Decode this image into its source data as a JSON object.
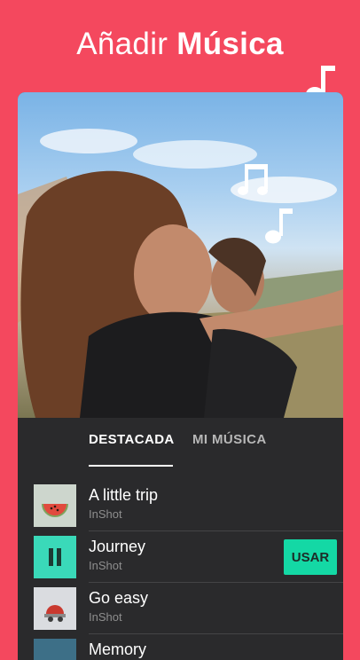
{
  "headline": {
    "regular": "Añadir",
    "bold": "Música"
  },
  "tabs": [
    {
      "label": "DESTACADA",
      "active": true
    },
    {
      "label": "MI MÚSICA",
      "active": false
    }
  ],
  "tracks": [
    {
      "title": "A little trip",
      "artist": "InShot",
      "playing": false,
      "thumb_color": "#c9d2c8"
    },
    {
      "title": "Journey",
      "artist": "InShot",
      "playing": true,
      "thumb_color": "#3ad9b9",
      "action_label": "USAR"
    },
    {
      "title": "Go easy",
      "artist": "InShot",
      "playing": false,
      "thumb_color": "#d9dbdf"
    },
    {
      "title": "Memory",
      "artist": "",
      "playing": false,
      "thumb_color": "#3d6f87"
    }
  ],
  "colors": {
    "background": "#f4485e",
    "panel": "#2a2a2c",
    "accent": "#14d8a5"
  },
  "icons": [
    "music-note-icon",
    "pause-icon"
  ]
}
